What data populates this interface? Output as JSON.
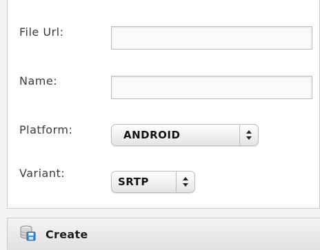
{
  "form": {
    "file_url_label": "File Url:",
    "file_url_value": "",
    "name_label": "Name:",
    "name_value": "",
    "platform_label": "Platform:",
    "platform_selected": "ANDROID",
    "variant_label": "Variant:",
    "variant_selected": "SRTP"
  },
  "toolbar": {
    "create_label": "Create",
    "create_icon": "database-save-icon"
  },
  "colors": {
    "panel_background": "#ffffff",
    "page_background": "#f4f4f4",
    "border": "#c9c9c9",
    "icon_blue": "#3f8fd8"
  }
}
